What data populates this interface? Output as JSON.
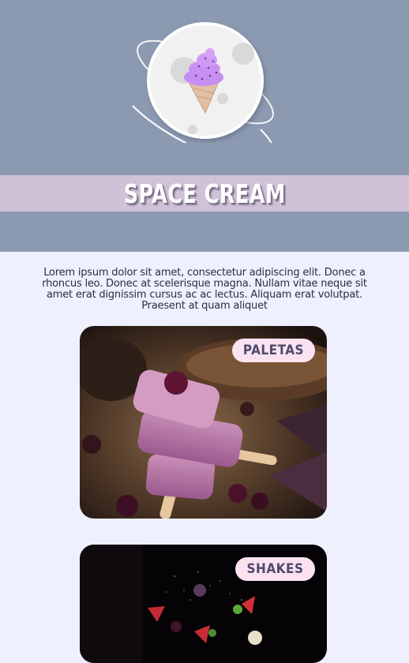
{
  "brand": {
    "title": "SPACE CREAM",
    "logo_icon": "ice-cream-planet-icon"
  },
  "intro": {
    "text": "Lorem ipsum dolor sit amet, consectetur adipiscing elit. Donec a rhoncus leo. Donec at scelerisque magna. Nullam vitae neque sit amet erat dignissim cursus ac ac lectus. Aliquam erat volutpat. Praesent at quam aliquet"
  },
  "cards": [
    {
      "label": "PALETAS",
      "image": "berry-popsicles-photo"
    },
    {
      "label": "SHAKES",
      "image": "floating-berries-photo"
    }
  ],
  "colors": {
    "header_bg": "#8b99b1",
    "title_band": "#cfc2d6",
    "page_bg": "#eff0fd",
    "badge_bg": "#fbe2f1",
    "badge_text": "#4d4a6c"
  }
}
